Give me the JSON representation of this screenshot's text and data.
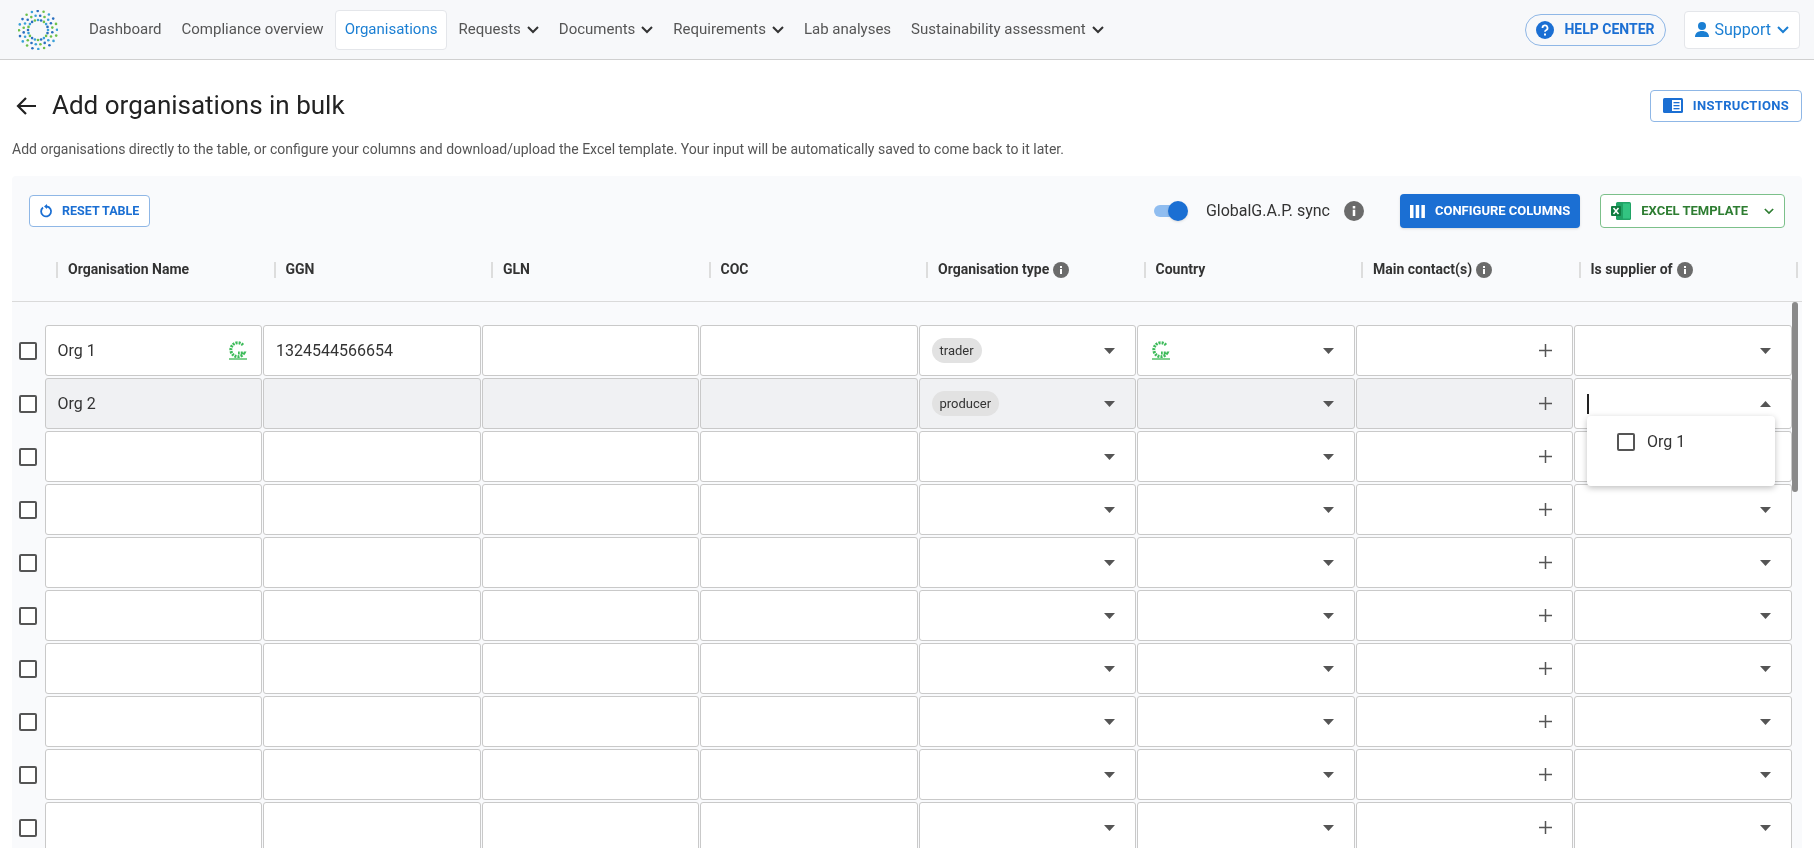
{
  "nav": {
    "items": [
      {
        "label": "Dashboard",
        "selected": false,
        "dropdown": false
      },
      {
        "label": "Compliance overview",
        "selected": false,
        "dropdown": false
      },
      {
        "label": "Organisations",
        "selected": true,
        "dropdown": false
      },
      {
        "label": "Requests",
        "selected": false,
        "dropdown": true
      },
      {
        "label": "Documents",
        "selected": false,
        "dropdown": true
      },
      {
        "label": "Requirements",
        "selected": false,
        "dropdown": true
      },
      {
        "label": "Lab analyses",
        "selected": false,
        "dropdown": false
      },
      {
        "label": "Sustainability assessment",
        "selected": false,
        "dropdown": true
      }
    ],
    "help": "HELP CENTER",
    "account": "Support"
  },
  "page": {
    "title": "Add organisations in bulk",
    "instructions": "INSTRUCTIONS",
    "description": "Add organisations directly to the table, or configure your columns and download/upload the Excel template. Your input will be automatically saved to come back to it later."
  },
  "toolbar": {
    "reset": "RESET TABLE",
    "sync": {
      "label": "GlobalG.A.P. sync",
      "on": true
    },
    "configure": "CONFIGURE COLUMNS",
    "template": "EXCEL TEMPLATE"
  },
  "table": {
    "columns": [
      {
        "label": "Organisation Name",
        "kind": "name",
        "info": false
      },
      {
        "label": "GGN",
        "kind": "text",
        "info": false
      },
      {
        "label": "GLN",
        "kind": "text",
        "info": false
      },
      {
        "label": "COC",
        "kind": "text",
        "info": false
      },
      {
        "label": "Organisation type",
        "kind": "select",
        "info": true
      },
      {
        "label": "Country",
        "kind": "country",
        "info": false
      },
      {
        "label": "Main contact(s)",
        "kind": "add",
        "info": true
      },
      {
        "label": "Is supplier of",
        "kind": "select",
        "info": true
      }
    ],
    "rows": [
      {
        "checked": false,
        "highlighted": false,
        "synced": true,
        "cells": [
          {
            "value": "Org 1"
          },
          {
            "value": "1324544566654"
          },
          {},
          {},
          {
            "value": "trader",
            "open": false
          },
          {
            "open": false
          },
          {},
          {
            "open": false
          }
        ]
      },
      {
        "checked": false,
        "highlighted": true,
        "synced": false,
        "cells": [
          {
            "value": "Org 2"
          },
          {},
          {},
          {},
          {
            "value": "producer",
            "open": false
          },
          {
            "open": false
          },
          {},
          {
            "open": true,
            "menu": [
              {
                "label": "Org 1",
                "checked": false
              }
            ]
          }
        ]
      },
      {
        "checked": false,
        "highlighted": false,
        "synced": false,
        "cells": [
          {},
          {},
          {},
          {},
          {
            "open": false
          },
          {
            "open": false
          },
          {},
          {
            "open": false
          }
        ]
      },
      {
        "checked": false,
        "highlighted": false,
        "synced": false,
        "cells": [
          {},
          {},
          {},
          {},
          {
            "open": false
          },
          {
            "open": false
          },
          {},
          {
            "open": false
          }
        ]
      },
      {
        "checked": false,
        "highlighted": false,
        "synced": false,
        "cells": [
          {},
          {},
          {},
          {},
          {
            "open": false
          },
          {
            "open": false
          },
          {},
          {
            "open": false
          }
        ]
      },
      {
        "checked": false,
        "highlighted": false,
        "synced": false,
        "cells": [
          {},
          {},
          {},
          {},
          {
            "open": false
          },
          {
            "open": false
          },
          {},
          {
            "open": false
          }
        ]
      },
      {
        "checked": false,
        "highlighted": false,
        "synced": false,
        "cells": [
          {},
          {},
          {},
          {},
          {
            "open": false
          },
          {
            "open": false
          },
          {},
          {
            "open": false
          }
        ]
      },
      {
        "checked": false,
        "highlighted": false,
        "synced": false,
        "cells": [
          {},
          {},
          {},
          {},
          {
            "open": false
          },
          {
            "open": false
          },
          {},
          {
            "open": false
          }
        ]
      },
      {
        "checked": false,
        "highlighted": false,
        "synced": false,
        "cells": [
          {},
          {},
          {},
          {},
          {
            "open": false
          },
          {
            "open": false
          },
          {},
          {
            "open": false
          }
        ]
      },
      {
        "checked": false,
        "highlighted": false,
        "synced": false,
        "cells": [
          {},
          {},
          {},
          {},
          {
            "open": false
          },
          {
            "open": false
          },
          {},
          {
            "open": false
          }
        ]
      }
    ]
  }
}
